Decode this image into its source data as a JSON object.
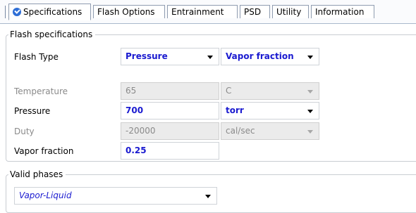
{
  "tabs": [
    {
      "label": "Specifications",
      "active": true,
      "icon": "check-circle-icon"
    },
    {
      "label": "Flash Options"
    },
    {
      "label": "Entrainment"
    },
    {
      "label": "PSD"
    },
    {
      "label": "Utility"
    },
    {
      "label": "Information"
    }
  ],
  "flash_specs": {
    "title": "Flash specifications",
    "flash_type": {
      "label": "Flash Type",
      "spec1": "Pressure",
      "spec2": "Vapor fraction"
    },
    "temperature": {
      "label": "Temperature",
      "value": "65",
      "unit": "C",
      "enabled": false
    },
    "pressure": {
      "label": "Pressure",
      "value": "700",
      "unit": "torr",
      "enabled": true
    },
    "duty": {
      "label": "Duty",
      "value": "-20000",
      "unit": "cal/sec",
      "enabled": false
    },
    "vapor_fraction": {
      "label": "Vapor fraction",
      "value": "0.25",
      "enabled": true
    }
  },
  "valid_phases": {
    "title": "Valid phases",
    "value": "Vapor-Liquid"
  },
  "colors": {
    "value_text": "#1a1ad0",
    "disabled_text": "#8a8a8a",
    "disabled_bg": "#ebebeb",
    "active_tab_icon": "#2f6fd6"
  }
}
